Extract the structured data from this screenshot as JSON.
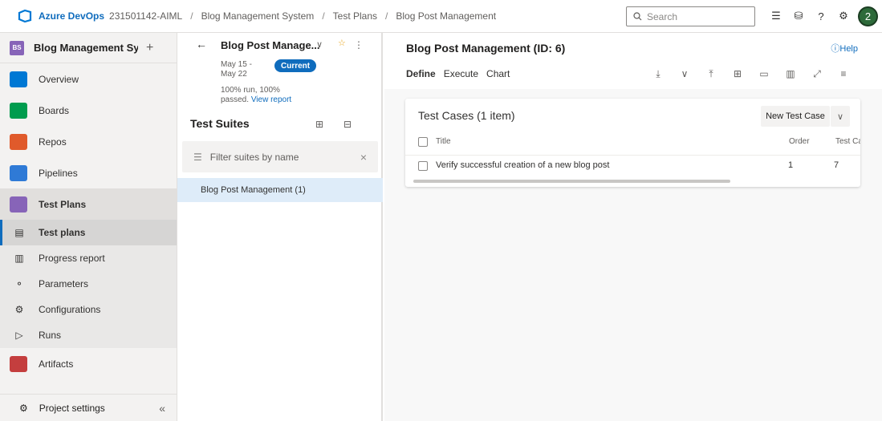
{
  "topbar": {
    "brand": "Azure DevOps",
    "breadcrumbs": [
      "231501142-AIML",
      "Blog Management System",
      "Test Plans",
      "Blog Post Management"
    ],
    "search_placeholder": "Search",
    "avatar_initial": "2"
  },
  "leftnav": {
    "project_badge": "BS",
    "project_name": "Blog Management Syst...",
    "items": [
      {
        "label": "Overview",
        "color": "#0078d4"
      },
      {
        "label": "Boards",
        "color": "#009c4e"
      },
      {
        "label": "Repos",
        "color": "#e05a2b"
      },
      {
        "label": "Pipelines",
        "color": "#2f7ad6"
      },
      {
        "label": "Test Plans",
        "color": "#8764b8"
      }
    ],
    "sub_items": [
      {
        "label": "Test plans",
        "icon": "test-plans-icon"
      },
      {
        "label": "Progress report",
        "icon": "progress-report-icon"
      },
      {
        "label": "Parameters",
        "icon": "parameters-icon"
      },
      {
        "label": "Configurations",
        "icon": "configurations-icon"
      },
      {
        "label": "Runs",
        "icon": "runs-icon"
      }
    ],
    "artifacts": {
      "label": "Artifacts",
      "color": "#c43e3e"
    },
    "settings_label": "Project settings"
  },
  "suites_pane": {
    "plan_name": "Blog Post Manage...",
    "dates_line1": "May 15 -",
    "dates_line2": "May 22",
    "status_pill": "Current",
    "stats_line1": "100% run, 100%",
    "stats_line2": "passed.",
    "stats_link": "View report",
    "suites_title": "Test Suites",
    "filter_placeholder": "Filter suites by name",
    "suite_row": "Blog Post Management (1)"
  },
  "main": {
    "title": "Blog Post Management (ID: 6)",
    "help": "Help",
    "tabs": [
      "Define",
      "Execute",
      "Chart"
    ],
    "card_title": "Test Cases (1 item)",
    "new_button": "New Test Case",
    "columns": {
      "title": "Title",
      "order": "Order",
      "test_case": "Test Ca"
    },
    "rows": [
      {
        "title": "Verify successful creation of a new blog post",
        "order": "1",
        "test_case": "7"
      }
    ]
  }
}
